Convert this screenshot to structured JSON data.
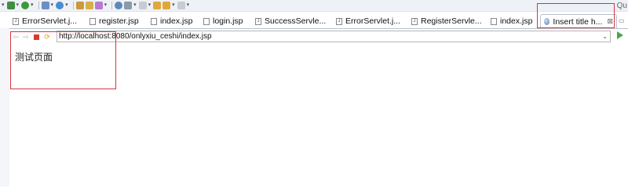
{
  "toolbar": {
    "quick_access": "Qu"
  },
  "tabs": [
    {
      "label": "ErrorServlet.j...",
      "icon": "java-file-icon"
    },
    {
      "label": "register.jsp",
      "icon": "jsp-file-icon"
    },
    {
      "label": "index.jsp",
      "icon": "jsp-file-icon"
    },
    {
      "label": "login.jsp",
      "icon": "jsp-file-icon"
    },
    {
      "label": "SuccessServle...",
      "icon": "java-file-icon"
    },
    {
      "label": "ErrorServlet.j...",
      "icon": "java-file-icon"
    },
    {
      "label": "RegisterServle...",
      "icon": "java-file-icon"
    },
    {
      "label": "index.jsp",
      "icon": "jsp-file-icon"
    },
    {
      "label": "Insert title h...",
      "icon": "globe-icon",
      "active": true,
      "close": "⊠"
    }
  ],
  "browser": {
    "url": "http://localhost:8080/onlyxiu_ceshi/index.jsp",
    "content_text": "测试页面"
  },
  "colors": {
    "annotation_red": "#d9333f",
    "stop_red": "#d63b2f",
    "go_green": "#4aa64a"
  }
}
